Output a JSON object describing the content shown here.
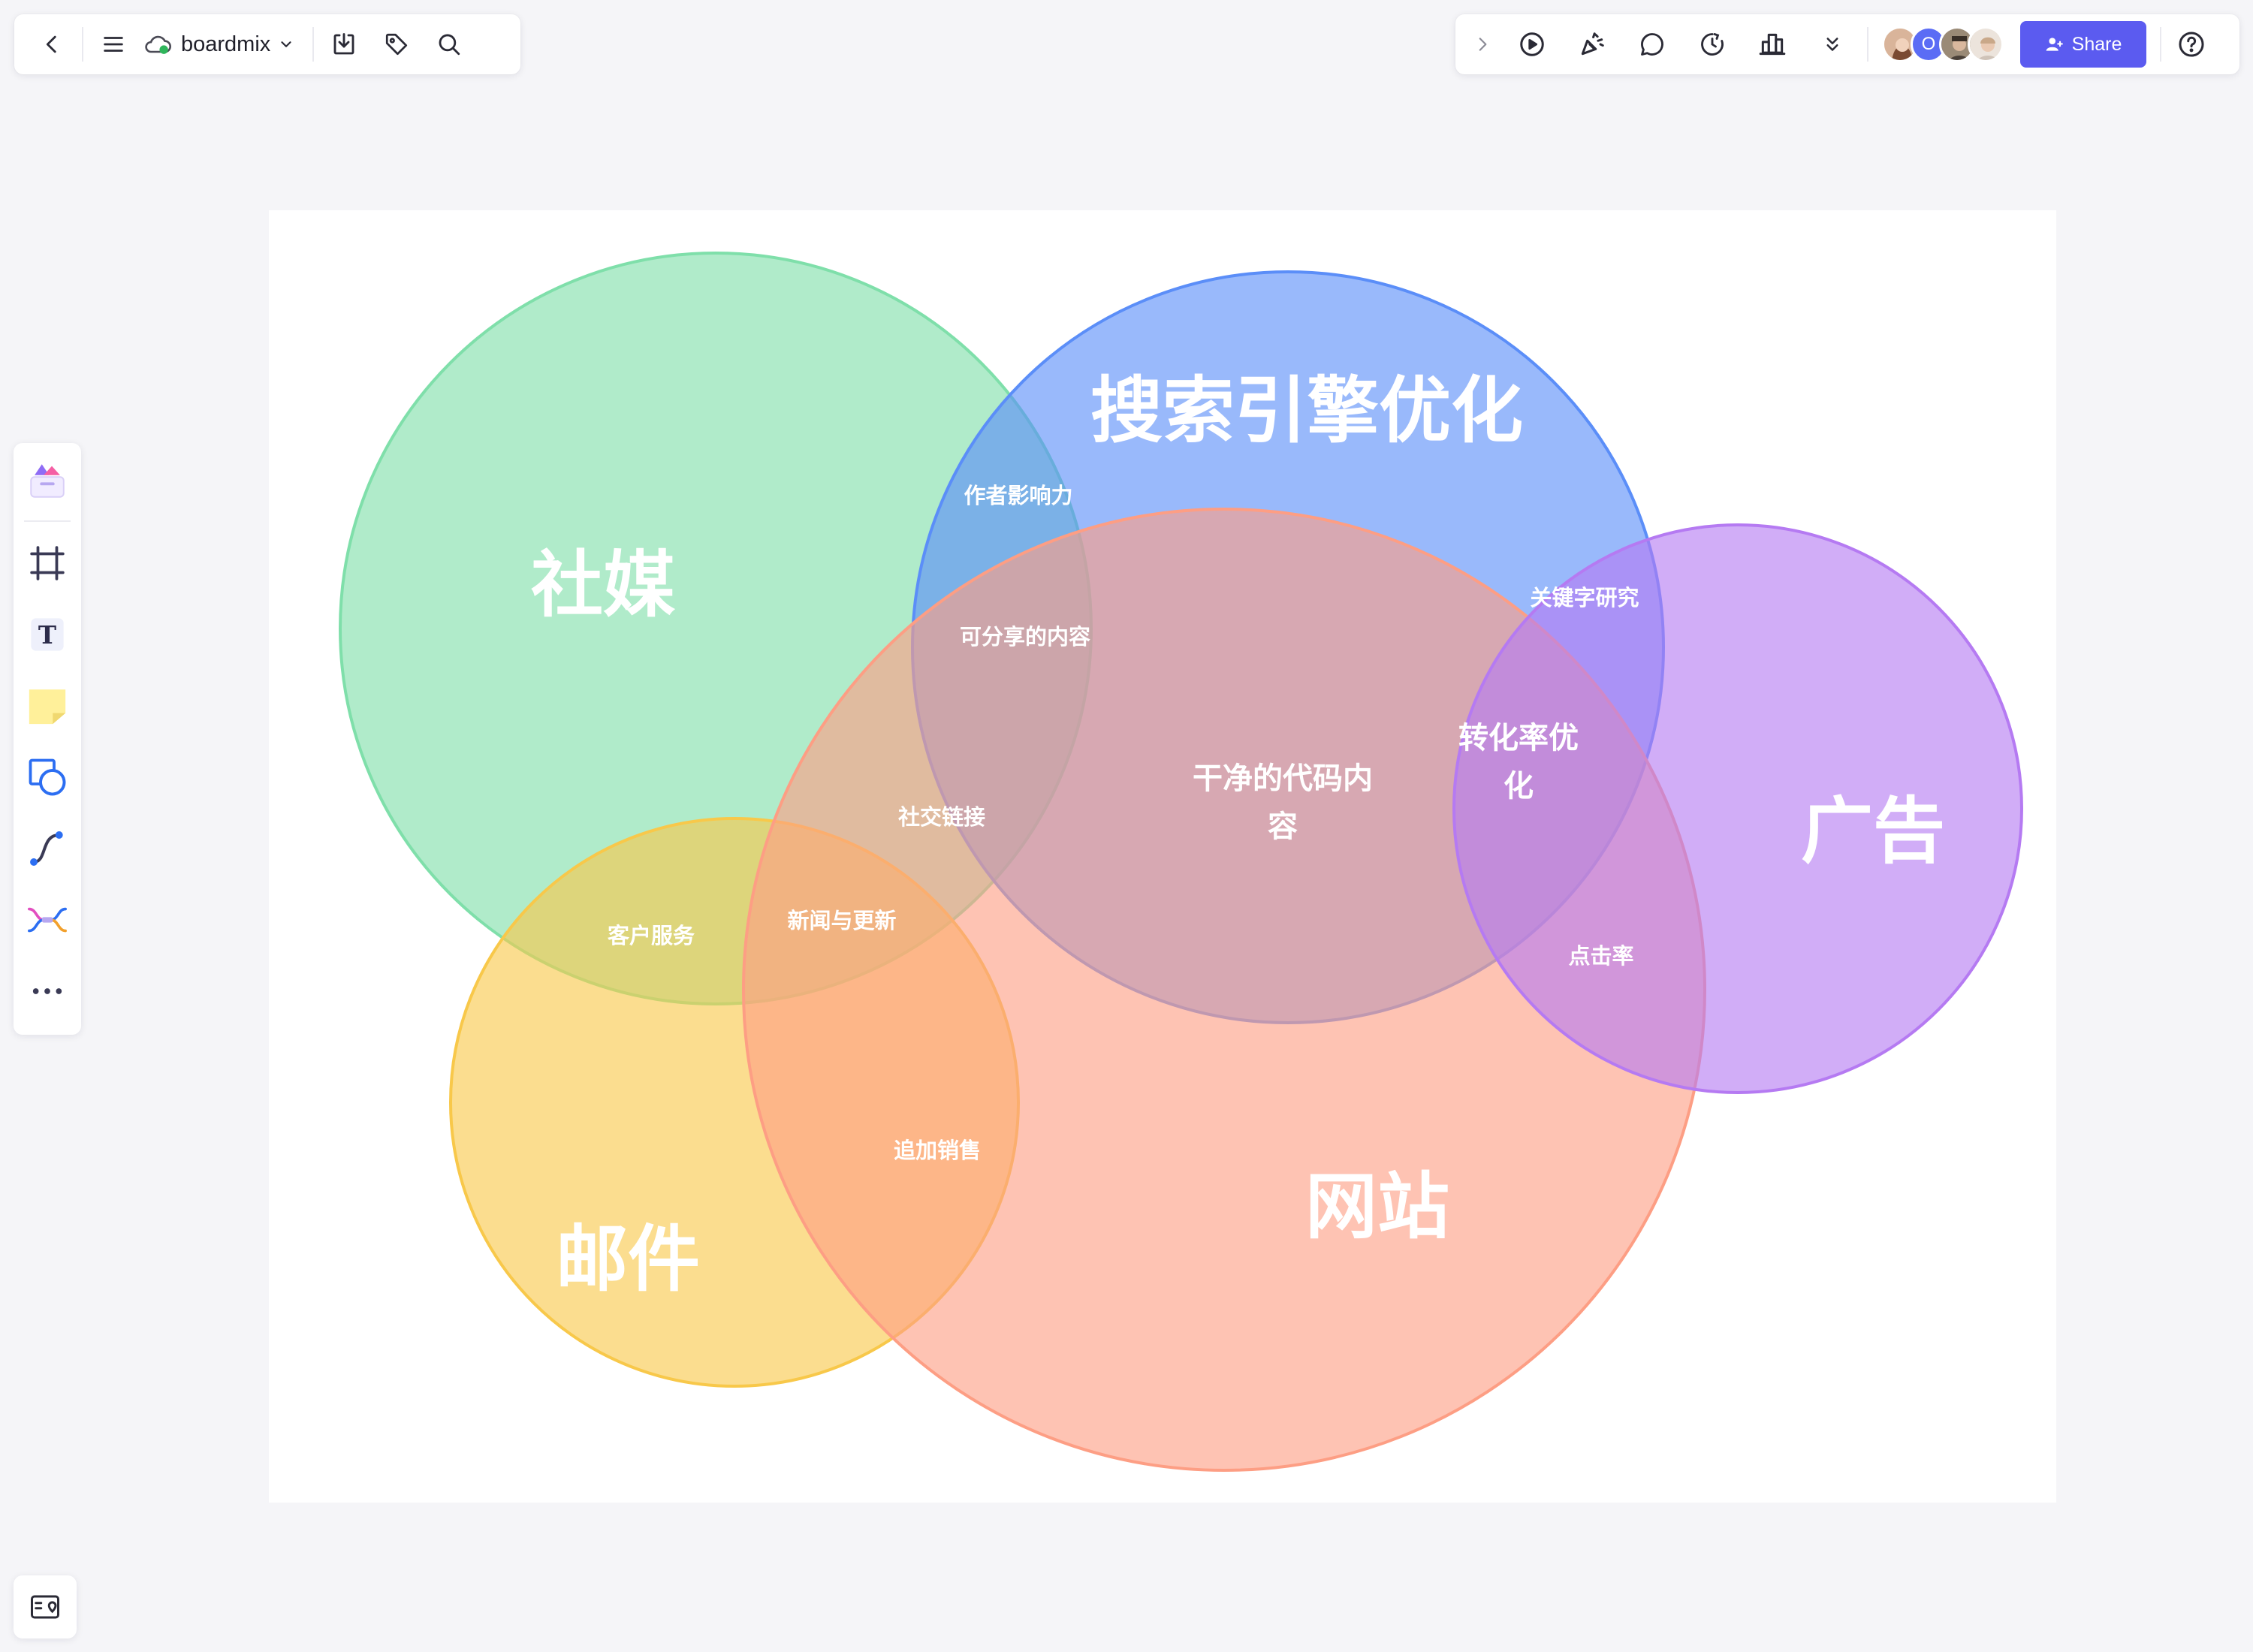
{
  "app": {
    "doc_name": "boardmix"
  },
  "toolbar_left": {
    "icons": [
      "back-icon",
      "menu-icon",
      "cloud-icon",
      "chevron-down-icon",
      "download-icon",
      "tag-icon",
      "search-icon"
    ]
  },
  "toolbar_right": {
    "icons": [
      "expand-icon",
      "play-icon",
      "celebrate-icon",
      "comment-icon",
      "timer-icon",
      "vote-icon",
      "more-chevrons-icon",
      "help-icon"
    ],
    "avatar_letter": "O",
    "share_label": "Share"
  },
  "side_toolbar": {
    "icons": [
      "templates-icon",
      "frame-icon",
      "text-icon",
      "sticky-note-icon",
      "shape-icon",
      "connector-icon",
      "mindmap-icon",
      "more-icon"
    ]
  },
  "venn": {
    "sets": [
      {
        "label": "社媒",
        "color": "#7fdfaa"
      },
      {
        "label": "搜索引擎优化",
        "color": "#5b8ef8"
      },
      {
        "label": "广告",
        "color": "#b57af2"
      },
      {
        "label": "邮件",
        "color": "#f8c84a"
      },
      {
        "label": "网站",
        "color": "#fd9e84"
      }
    ],
    "overlaps": [
      "作者影响力",
      "关键字研究",
      "可分享的内容",
      "转化率优化",
      "干净的代码内容",
      "社交链接",
      "新闻与更新",
      "客户服务",
      "点击率",
      "追加销售"
    ]
  }
}
